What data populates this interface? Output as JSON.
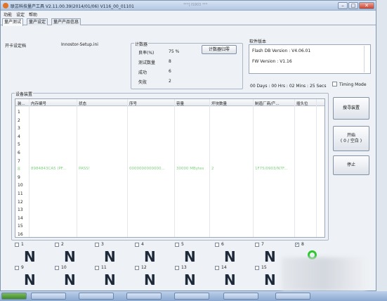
{
  "window": {
    "title": "联芸科技量产工具 V2.11.00.39(2014/01/06)   V116_00_01101",
    "title_extra": "***] IS903 ***",
    "controls": {
      "minimize": "–",
      "maximize": "□",
      "close": "✕"
    }
  },
  "menu": [
    "功能",
    "设定",
    "帮助"
  ],
  "tabs": [
    "量产测试",
    "量产设定",
    "量产产品信息"
  ],
  "config": {
    "label": "开卡设定档",
    "file": "Innostor-Setup.ini"
  },
  "counter": {
    "title": "计数器",
    "rows": [
      {
        "label": "良率(%)",
        "value": "75 %"
      },
      {
        "label": "测试数量",
        "value": "8"
      },
      {
        "label": "成功",
        "value": "6"
      },
      {
        "label": "失败",
        "value": "2"
      }
    ],
    "reset_button": "计数器归零"
  },
  "version": {
    "title": "软件版本",
    "flash_db": "Flash DB Version :  V4.06.01",
    "fw": "FW Version :  V1.16",
    "uptime": "00 Days : 00 Hrs : 02 Mins : 25 Secs",
    "timing_mode": "Timing Mode"
  },
  "device_list": {
    "title": "设备装置",
    "headers": [
      "装...",
      "内存编号",
      "状态",
      "序号",
      "容量",
      "坏块数量",
      "制造厂商/产...",
      "插头位"
    ],
    "rows": [
      {
        "n": "1"
      },
      {
        "n": "2"
      },
      {
        "n": "3"
      },
      {
        "n": "4"
      },
      {
        "n": "5"
      },
      {
        "n": "6"
      },
      {
        "n": "7"
      },
      {
        "n": "8",
        "mem": "8984843CA5 (PF...",
        "status": "PASS!",
        "serial": "0000000000000...",
        "capacity": "30000 MBytes",
        "bad": "2",
        "vendor": "1F75/0903/N7F..."
      },
      {
        "n": "9"
      },
      {
        "n": "10"
      },
      {
        "n": "11"
      },
      {
        "n": "12"
      },
      {
        "n": "13"
      },
      {
        "n": "14"
      },
      {
        "n": "15"
      },
      {
        "n": "16"
      }
    ]
  },
  "buttons": {
    "search": "搜寻装置",
    "start": "开始\n( 0 / 空白 )",
    "stop": "停止"
  },
  "slots": [
    {
      "n": "1",
      "state": "N",
      "checked": false
    },
    {
      "n": "2",
      "state": "N",
      "checked": false
    },
    {
      "n": "3",
      "state": "N",
      "checked": false
    },
    {
      "n": "4",
      "state": "N",
      "checked": false
    },
    {
      "n": "5",
      "state": "N",
      "checked": false
    },
    {
      "n": "6",
      "state": "N",
      "checked": false
    },
    {
      "n": "7",
      "state": "N",
      "checked": false
    },
    {
      "n": "8",
      "state": "O",
      "checked": true
    },
    {
      "n": "9",
      "state": "N",
      "checked": false
    },
    {
      "n": "10",
      "state": "N",
      "checked": false
    },
    {
      "n": "11",
      "state": "N",
      "checked": false
    },
    {
      "n": "12",
      "state": "N",
      "checked": false
    },
    {
      "n": "13",
      "state": "N",
      "checked": false
    },
    {
      "n": "14",
      "state": "N",
      "checked": false
    },
    {
      "n": "15",
      "state": "N",
      "checked": false
    }
  ],
  "colors": {
    "pass_text": "#7dd17d",
    "ok_ring": "#2ec52e",
    "title_bg": "#c6d6ec"
  }
}
